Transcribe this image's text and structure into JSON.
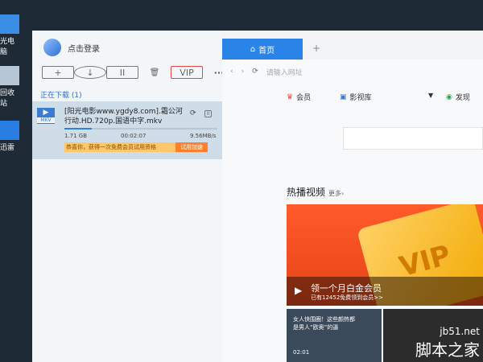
{
  "desktop": {
    "icons": [
      {
        "label": "光电脑"
      },
      {
        "label": "回收站"
      },
      {
        "label": "迅雷"
      }
    ]
  },
  "left": {
    "login_text": "点击登录",
    "toolbar": {
      "add": "+",
      "download": "↓",
      "pause": "II",
      "delete": "🗑",
      "vip": "VIP",
      "more": "···"
    },
    "section_title": "正在下载 (1)",
    "download": {
      "thumb_label": "MKV",
      "file_name": "[阳光电影www.ygdy8.com].霜公河行动.HD.720p.国语中字.mkv",
      "size": "1.71 GB",
      "time": "00:02:07",
      "speed": "9.56MB/s",
      "progress_pct": 18,
      "promo_text": "恭喜你，获得一次免费会员试用资格",
      "promo_button": "试用加速"
    }
  },
  "right": {
    "tab_label": "首页",
    "tab_plus": "+",
    "address_placeholder": "请输入网址",
    "nav": {
      "member": "会员",
      "library": "影视库",
      "discover": "发现"
    },
    "hot_title": "热播视频",
    "hot_more": "更多›",
    "banner": {
      "vip_text": "VIP",
      "title": "领一个月白金会员",
      "subtitle": "已有12452免费领到会员>>"
    },
    "thumb1": {
      "caption": "女人快围圈！这些颜热都是男人“欧奥”的逼",
      "time": "02:01"
    }
  },
  "watermark": {
    "site": "jb51.net",
    "name": "脚本之家"
  },
  "colors": {
    "accent": "#2a84e8",
    "promo": "#ffc76b",
    "promo_button": "#ff7f2a",
    "banner": "#ff5a2a"
  }
}
